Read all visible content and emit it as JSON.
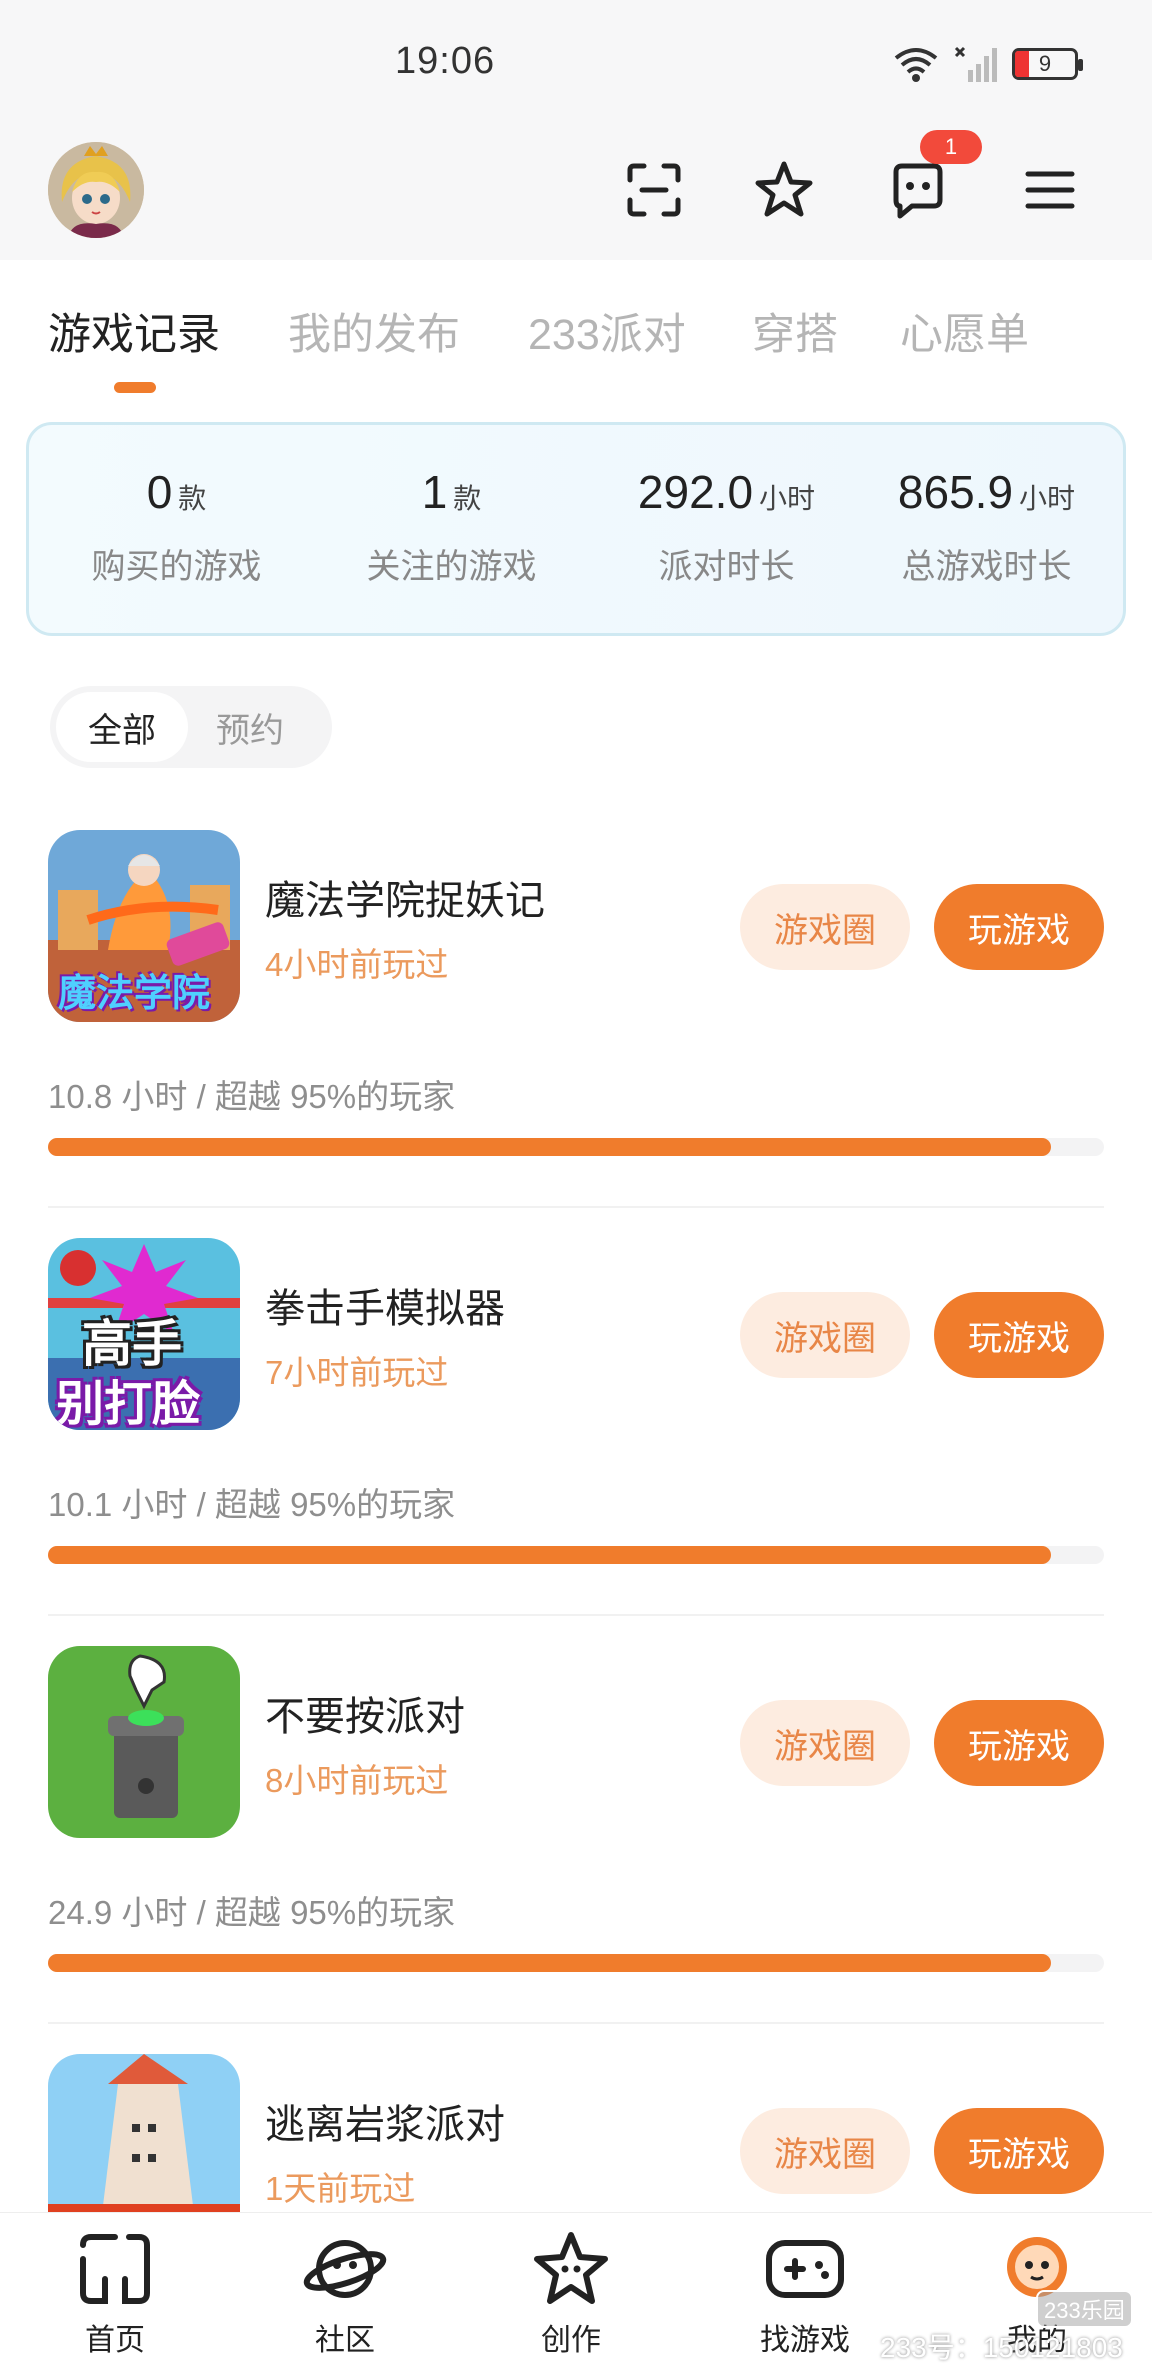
{
  "status_bar": {
    "time": "19:06",
    "battery": "9"
  },
  "header": {
    "notification_count": "1"
  },
  "tabs": [
    "游戏记录",
    "我的发布",
    "233派对",
    "穿搭",
    "心愿单"
  ],
  "stats": [
    {
      "value": "0",
      "unit": "款",
      "label": "购买的游戏"
    },
    {
      "value": "1",
      "unit": "款",
      "label": "关注的游戏"
    },
    {
      "value": "292.0",
      "unit": "小时",
      "label": "派对时长"
    },
    {
      "value": "865.9",
      "unit": "小时",
      "label": "总游戏时长"
    }
  ],
  "filters": [
    "全部",
    "预约"
  ],
  "games": [
    {
      "title": "魔法学院捉妖记",
      "last_played": "4小时前玩过",
      "stat": "10.8 小时 / 超越 95%的玩家",
      "progress": 0.95,
      "circle_label": "游戏圈",
      "play_label": "玩游戏",
      "icon_text": "魔法学院"
    },
    {
      "title": "拳击手模拟器",
      "last_played": "7小时前玩过",
      "stat": "10.1 小时 / 超越 95%的玩家",
      "progress": 0.95,
      "circle_label": "游戏圈",
      "play_label": "玩游戏",
      "icon_text_top": "高手",
      "icon_text_bottom": "别打脸"
    },
    {
      "title": "不要按派对",
      "last_played": "8小时前玩过",
      "stat": "24.9 小时 / 超越 95%的玩家",
      "progress": 0.95,
      "circle_label": "游戏圈",
      "play_label": "玩游戏"
    },
    {
      "title": "逃离岩浆派对",
      "last_played": "1天前玩过",
      "circle_label": "游戏圈",
      "play_label": "玩游戏"
    }
  ],
  "bottom_nav": [
    {
      "label": "首页",
      "icon": "home-icon"
    },
    {
      "label": "社区",
      "icon": "planet-icon"
    },
    {
      "label": "创作",
      "icon": "star-face-icon"
    },
    {
      "label": "找游戏",
      "icon": "gamepad-icon"
    },
    {
      "label": "我的",
      "icon": "profile-face-icon"
    }
  ],
  "watermark": {
    "text": "233号：150121803",
    "logo": "233乐园"
  },
  "colors": {
    "accent": "#f07c2c",
    "accent_light": "#fdece0",
    "badge": "#f24a3b"
  }
}
